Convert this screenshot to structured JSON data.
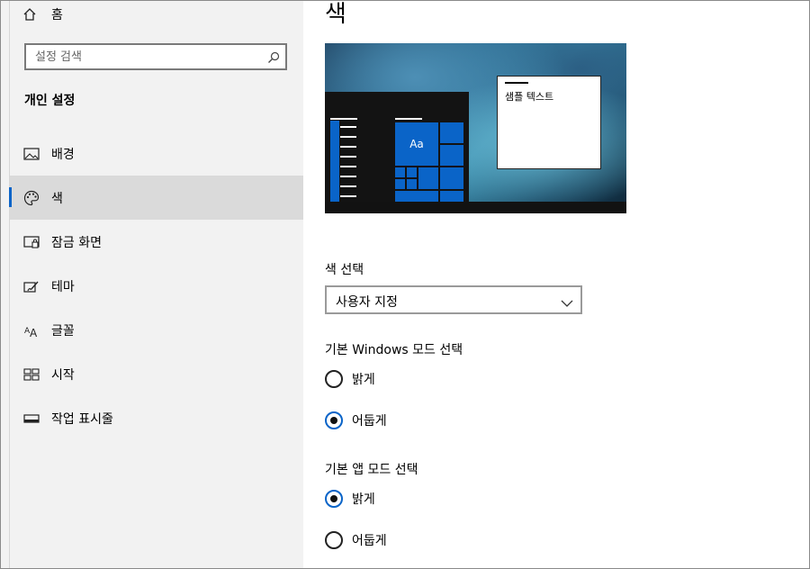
{
  "sidebar": {
    "home_label": "홈",
    "search_placeholder": "설정 검색",
    "section_title": "개인 설정",
    "items": [
      {
        "label": "배경",
        "icon": "picture-icon"
      },
      {
        "label": "색",
        "icon": "palette-icon",
        "active": true
      },
      {
        "label": "잠금 화면",
        "icon": "lock-screen-icon"
      },
      {
        "label": "테마",
        "icon": "theme-brush-icon"
      },
      {
        "label": "글꼴",
        "icon": "font-icon"
      },
      {
        "label": "시작",
        "icon": "start-grid-icon"
      },
      {
        "label": "작업 표시줄",
        "icon": "taskbar-icon"
      }
    ]
  },
  "main": {
    "title": "색",
    "preview": {
      "tile_text": "Aa",
      "window_text": "샘플 텍스트"
    },
    "color_select": {
      "label": "색 선택",
      "value": "사용자 지정"
    },
    "windows_mode": {
      "label": "기본 Windows 모드 선택",
      "options": [
        {
          "label": "밝게",
          "checked": false
        },
        {
          "label": "어둡게",
          "checked": true
        }
      ]
    },
    "app_mode": {
      "label": "기본 앱 모드 선택",
      "options": [
        {
          "label": "밝게",
          "checked": true
        },
        {
          "label": "어둡게",
          "checked": false
        }
      ]
    }
  },
  "colors": {
    "accent": "#0a64c8",
    "sidebar_bg": "#f2f2f2",
    "selected_bg": "#dadada"
  }
}
